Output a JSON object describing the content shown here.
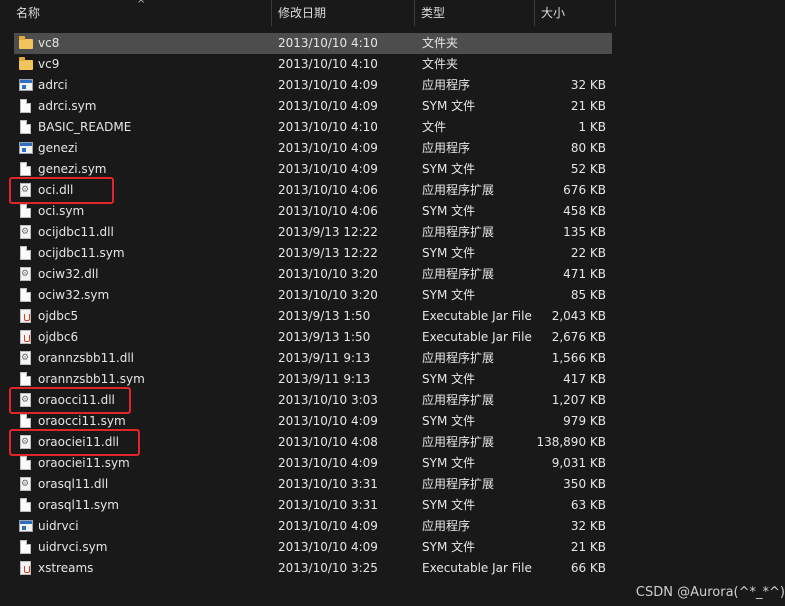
{
  "columns": {
    "name": "名称",
    "date": "修改日期",
    "type": "类型",
    "size": "大小"
  },
  "sort_arrow": "^",
  "files": [
    {
      "name": "vc8",
      "date": "2013/10/10 4:10",
      "type": "文件夹",
      "size": "",
      "icon": "folder-icon"
    },
    {
      "name": "vc9",
      "date": "2013/10/10 4:10",
      "type": "文件夹",
      "size": "",
      "icon": "folder-icon"
    },
    {
      "name": "adrci",
      "date": "2013/10/10 4:09",
      "type": "应用程序",
      "size": "32 KB",
      "icon": "application-icon"
    },
    {
      "name": "adrci.sym",
      "date": "2013/10/10 4:09",
      "type": "SYM 文件",
      "size": "21 KB",
      "icon": "file-icon"
    },
    {
      "name": "BASIC_README",
      "date": "2013/10/10 4:10",
      "type": "文件",
      "size": "1 KB",
      "icon": "file-icon"
    },
    {
      "name": "genezi",
      "date": "2013/10/10 4:09",
      "type": "应用程序",
      "size": "80 KB",
      "icon": "application-icon"
    },
    {
      "name": "genezi.sym",
      "date": "2013/10/10 4:09",
      "type": "SYM 文件",
      "size": "52 KB",
      "icon": "file-icon"
    },
    {
      "name": "oci.dll",
      "date": "2013/10/10 4:06",
      "type": "应用程序扩展",
      "size": "676 KB",
      "icon": "dll-icon"
    },
    {
      "name": "oci.sym",
      "date": "2013/10/10 4:06",
      "type": "SYM 文件",
      "size": "458 KB",
      "icon": "file-icon"
    },
    {
      "name": "ocijdbc11.dll",
      "date": "2013/9/13 12:22",
      "type": "应用程序扩展",
      "size": "135 KB",
      "icon": "dll-icon"
    },
    {
      "name": "ocijdbc11.sym",
      "date": "2013/9/13 12:22",
      "type": "SYM 文件",
      "size": "22 KB",
      "icon": "file-icon"
    },
    {
      "name": "ociw32.dll",
      "date": "2013/10/10 3:20",
      "type": "应用程序扩展",
      "size": "471 KB",
      "icon": "dll-icon"
    },
    {
      "name": "ociw32.sym",
      "date": "2013/10/10 3:20",
      "type": "SYM 文件",
      "size": "85 KB",
      "icon": "file-icon"
    },
    {
      "name": "ojdbc5",
      "date": "2013/9/13 1:50",
      "type": "Executable Jar File",
      "size": "2,043 KB",
      "icon": "jar-icon"
    },
    {
      "name": "ojdbc6",
      "date": "2013/9/13 1:50",
      "type": "Executable Jar File",
      "size": "2,676 KB",
      "icon": "jar-icon"
    },
    {
      "name": "orannzsbb11.dll",
      "date": "2013/9/11 9:13",
      "type": "应用程序扩展",
      "size": "1,566 KB",
      "icon": "dll-icon"
    },
    {
      "name": "orannzsbb11.sym",
      "date": "2013/9/11 9:13",
      "type": "SYM 文件",
      "size": "417 KB",
      "icon": "file-icon"
    },
    {
      "name": "oraocci11.dll",
      "date": "2013/10/10 3:03",
      "type": "应用程序扩展",
      "size": "1,207 KB",
      "icon": "dll-icon"
    },
    {
      "name": "oraocci11.sym",
      "date": "2013/10/10 4:09",
      "type": "SYM 文件",
      "size": "979 KB",
      "icon": "file-icon"
    },
    {
      "name": "oraociei11.dll",
      "date": "2013/10/10 4:08",
      "type": "应用程序扩展",
      "size": "138,890 KB",
      "icon": "dll-icon"
    },
    {
      "name": "oraociei11.sym",
      "date": "2013/10/10 4:09",
      "type": "SYM 文件",
      "size": "9,031 KB",
      "icon": "file-icon"
    },
    {
      "name": "orasql11.dll",
      "date": "2013/10/10 3:31",
      "type": "应用程序扩展",
      "size": "350 KB",
      "icon": "dll-icon"
    },
    {
      "name": "orasql11.sym",
      "date": "2013/10/10 3:31",
      "type": "SYM 文件",
      "size": "63 KB",
      "icon": "file-icon"
    },
    {
      "name": "uidrvci",
      "date": "2013/10/10 4:09",
      "type": "应用程序",
      "size": "32 KB",
      "icon": "application-icon"
    },
    {
      "name": "uidrvci.sym",
      "date": "2013/10/10 4:09",
      "type": "SYM 文件",
      "size": "21 KB",
      "icon": "file-icon"
    },
    {
      "name": "xstreams",
      "date": "2013/10/10 3:25",
      "type": "Executable Jar File",
      "size": "66 KB",
      "icon": "jar-icon"
    }
  ],
  "selected_row": "vc8",
  "highlighted_files": [
    "oci.dll",
    "oraocci11.dll",
    "oraociei11.dll"
  ],
  "highlight_color": "#e0262a",
  "watermark": "CSDN @Aurora(^*_*^)"
}
